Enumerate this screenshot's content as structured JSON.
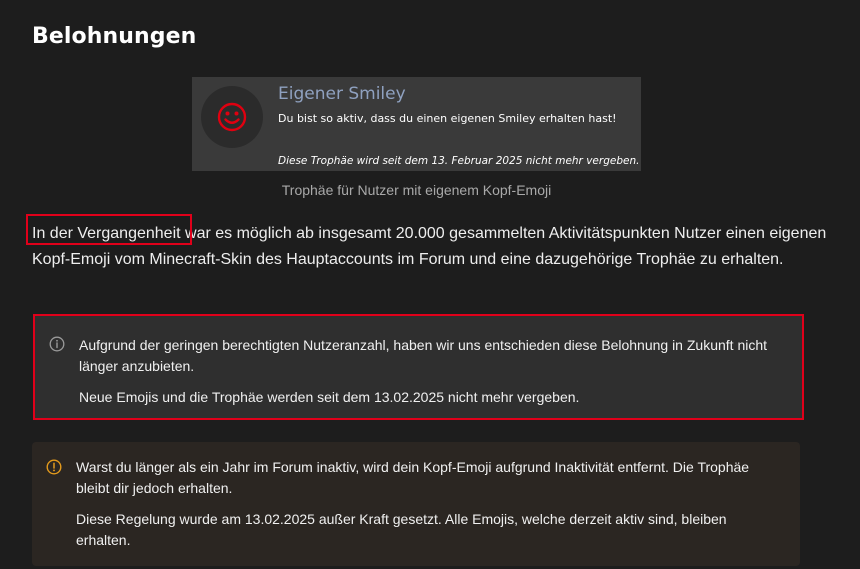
{
  "page": {
    "title": "Belohnungen"
  },
  "trophy": {
    "title": "Eigener Smiley",
    "description": "Du bist so aktiv, dass du einen eigenen Smiley erhalten hast!",
    "note": "Diese Trophäe wird seit dem 13. Februar 2025 nicht mehr vergeben.",
    "icon": "smiley-icon",
    "icon_color": "#e00010",
    "caption": "Trophäe für Nutzer mit eigenem Kopf-Emoji"
  },
  "intro": {
    "highlight": "In der Vergangenheit",
    "rest": " war es möglich ab insgesamt 20.000 gesammelten Aktivitätspunkten Nutzer einen eigenen Kopf-Emoji vom Minecraft-Skin des Hauptaccounts im Forum und eine dazugehörige Trophäe zu erhalten."
  },
  "info_callout": {
    "icon": "info-circle-icon",
    "paragraph1": "Aufgrund der geringen berechtigten Nutzeranzahl, haben wir uns entschieden diese Belohnung in Zukunft nicht länger anzubieten.",
    "paragraph2": "Neue Emojis und die Trophäe werden seit dem 13.02.2025 nicht mehr vergeben."
  },
  "warning_callout": {
    "icon": "warning-circle-icon",
    "icon_color": "#e39a1c",
    "paragraph1": "Warst du länger als ein Jahr im Forum inaktiv, wird dein Kopf-Emoji aufgrund Inaktivität entfernt. Die Trophäe bleibt dir jedoch erhalten.",
    "paragraph2": "Diese Regelung wurde am 13.02.2025 außer Kraft gesetzt. Alle Emojis, welche derzeit aktiv sind, bleiben erhalten."
  },
  "colors": {
    "background": "#1d1d1d",
    "highlight_border": "#e0001a",
    "trophy_title": "#8fa1c0"
  }
}
